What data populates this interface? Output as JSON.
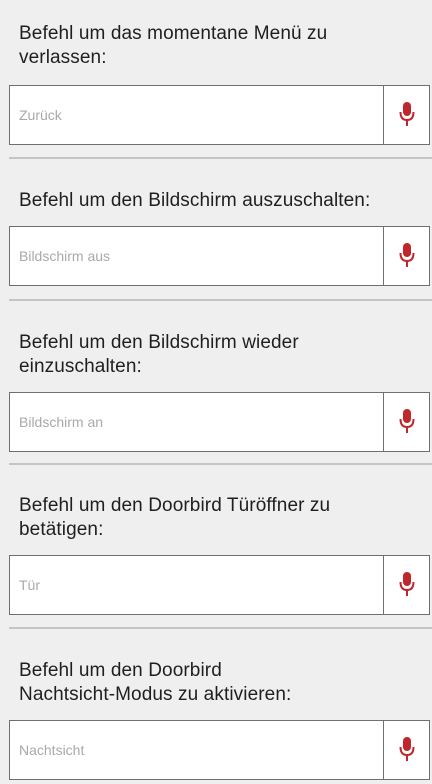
{
  "colors": {
    "background": "#efefef",
    "field_border": "#6f6f6f",
    "mic_icon": "#c0272d",
    "placeholder": "#a9a9a9",
    "divider": "#c4c4c4"
  },
  "commands": [
    {
      "label_lines": [
        "Befehl um das momentane Menü zu",
        "verlassen:"
      ],
      "placeholder": "Zurück",
      "value": "",
      "icon": "microphone-icon"
    },
    {
      "label_lines": [
        "Befehl um den Bildschirm auszuschalten:"
      ],
      "placeholder": "Bildschirm aus",
      "value": "",
      "icon": "microphone-icon"
    },
    {
      "label_lines": [
        "Befehl um den Bildschirm wieder",
        "einzuschalten:"
      ],
      "placeholder": "Bildschirm an",
      "value": "",
      "icon": "microphone-icon"
    },
    {
      "label_lines": [
        "Befehl um den Doorbird Türöffner zu",
        "betätigen:"
      ],
      "placeholder": "Tür",
      "value": "",
      "icon": "microphone-icon"
    },
    {
      "label_lines": [
        "Befehl um den Doorbird",
        "Nachtsicht-Modus zu aktivieren:"
      ],
      "placeholder": "Nachtsicht",
      "value": "",
      "icon": "microphone-icon"
    }
  ]
}
